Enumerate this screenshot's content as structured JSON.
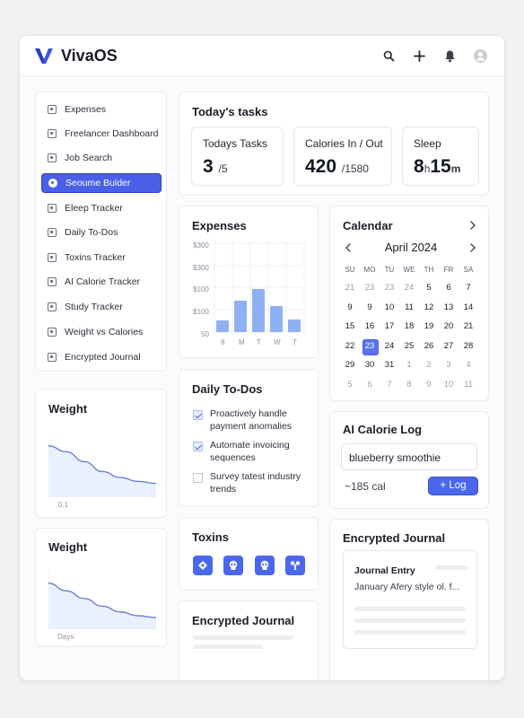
{
  "app": {
    "name": "VivaOS"
  },
  "header": {
    "icons": [
      "search-icon",
      "plus-icon",
      "bell-icon",
      "user-avatar-icon"
    ]
  },
  "sidebar": {
    "items": [
      {
        "label": "Expenses",
        "icon": "wallet-icon",
        "active": false
      },
      {
        "label": "Freelancer Dashboard",
        "icon": "dashboard-icon",
        "active": false
      },
      {
        "label": "Job Search",
        "icon": "briefcase-icon",
        "active": false
      },
      {
        "label": "Seoume Bulder",
        "icon": "resume-icon",
        "active": true
      },
      {
        "label": "Eleep Tracker",
        "icon": "sleep-icon",
        "active": false
      },
      {
        "label": "Daily To-Dos",
        "icon": "checklist-icon",
        "active": false
      },
      {
        "label": "Toxins Tracker",
        "icon": "flask-icon",
        "active": false
      },
      {
        "label": "AI Calorie Tracker",
        "icon": "calorie-icon",
        "active": false
      },
      {
        "label": "Study Tracker",
        "icon": "book-icon",
        "active": false
      },
      {
        "label": "Weight vs Calories",
        "icon": "scale-icon",
        "active": false
      },
      {
        "label": "Encrypted Journal",
        "icon": "lock-icon",
        "active": false
      }
    ]
  },
  "weight1": {
    "title": "Weight",
    "x_label": "0.1"
  },
  "weight2": {
    "title": "Weight",
    "x_label": "Days"
  },
  "tasks": {
    "title": "Today's tasks",
    "stats": [
      {
        "label": "Todays Tasks",
        "value": "3",
        "sub": "/5"
      },
      {
        "label": "Calories In / Out",
        "value": "420",
        "sub": "/1580"
      },
      {
        "label": "Sleep",
        "hours": "8",
        "hours_unit": "h",
        "minutes": "15",
        "minutes_unit": "m"
      }
    ]
  },
  "expenses": {
    "title": "Expenses",
    "y_ticks": [
      "$300",
      "$300",
      "$100",
      "$100",
      "50"
    ],
    "x_ticks": [
      "8",
      "M",
      "T",
      "W",
      "T"
    ]
  },
  "todos": {
    "title": "Daily To-Dos",
    "items": [
      {
        "text": "Proactively handle payment anomalies",
        "done": true
      },
      {
        "text": "Automate invoicing sequences",
        "done": true
      },
      {
        "text": "Survey tatest industry trends",
        "done": false
      }
    ]
  },
  "toxins": {
    "title": "Toxins",
    "icons": [
      "hazard-icon",
      "skull-icon",
      "skull-icon",
      "biohazard-icon"
    ]
  },
  "journal_bottom": {
    "title": "Encrypted Journal"
  },
  "calendar": {
    "title": "Calendar",
    "month": "April 2024",
    "weekdays": [
      "SU",
      "MO",
      "TU",
      "WE",
      "TH",
      "FR",
      "SA"
    ],
    "weeks": [
      [
        "21",
        "23",
        "23",
        "24",
        "5",
        "6",
        "7"
      ],
      [
        "9",
        "9",
        "10",
        "11",
        "12",
        "13",
        "14"
      ],
      [
        "15",
        "16",
        "17",
        "18",
        "19",
        "20",
        "21"
      ],
      [
        "22",
        "23",
        "24",
        "25",
        "26",
        "27",
        "28"
      ],
      [
        "29",
        "30",
        "31",
        "1",
        "2",
        "3",
        "4"
      ],
      [
        "5",
        "6",
        "7",
        "8",
        "9",
        "10",
        "11"
      ]
    ],
    "muted": [
      [
        true,
        true,
        true,
        true,
        false,
        false,
        false
      ],
      [
        false,
        false,
        false,
        false,
        false,
        false,
        false
      ],
      [
        false,
        false,
        false,
        false,
        false,
        false,
        false
      ],
      [
        false,
        false,
        false,
        false,
        false,
        false,
        false
      ],
      [
        false,
        false,
        false,
        true,
        true,
        true,
        true
      ],
      [
        true,
        true,
        true,
        true,
        true,
        true,
        true
      ]
    ],
    "selected": {
      "week": 3,
      "day": 1
    }
  },
  "calorie_log": {
    "title": "AI Calorie Log",
    "input_value": "blueberry smoothie",
    "estimate": "~185 cal",
    "button": "+ Log"
  },
  "journal": {
    "title": "Encrypted Journal",
    "entry_title": "Journal Entry",
    "entry_preview": "January Afery style ol. f..."
  },
  "chart_data": [
    {
      "type": "bar",
      "title": "Expenses",
      "categories": [
        "8",
        "M",
        "T",
        "W",
        "T"
      ],
      "values": [
        82,
        138,
        172,
        124,
        86
      ],
      "ylim": [
        50,
        300
      ],
      "color": "#8fb0f5"
    },
    {
      "type": "area",
      "title": "Weight",
      "x": [
        0,
        1,
        2,
        3,
        4,
        5,
        6
      ],
      "values": [
        86,
        83,
        78,
        73,
        70,
        68,
        67
      ],
      "color": "#5b78d6"
    },
    {
      "type": "area",
      "title": "Weight",
      "xlabel": "Days",
      "x": [
        0,
        1,
        2,
        3,
        4,
        5,
        6
      ],
      "values": [
        84,
        80,
        76,
        72,
        69,
        67,
        66
      ],
      "color": "#5b78d6"
    }
  ]
}
